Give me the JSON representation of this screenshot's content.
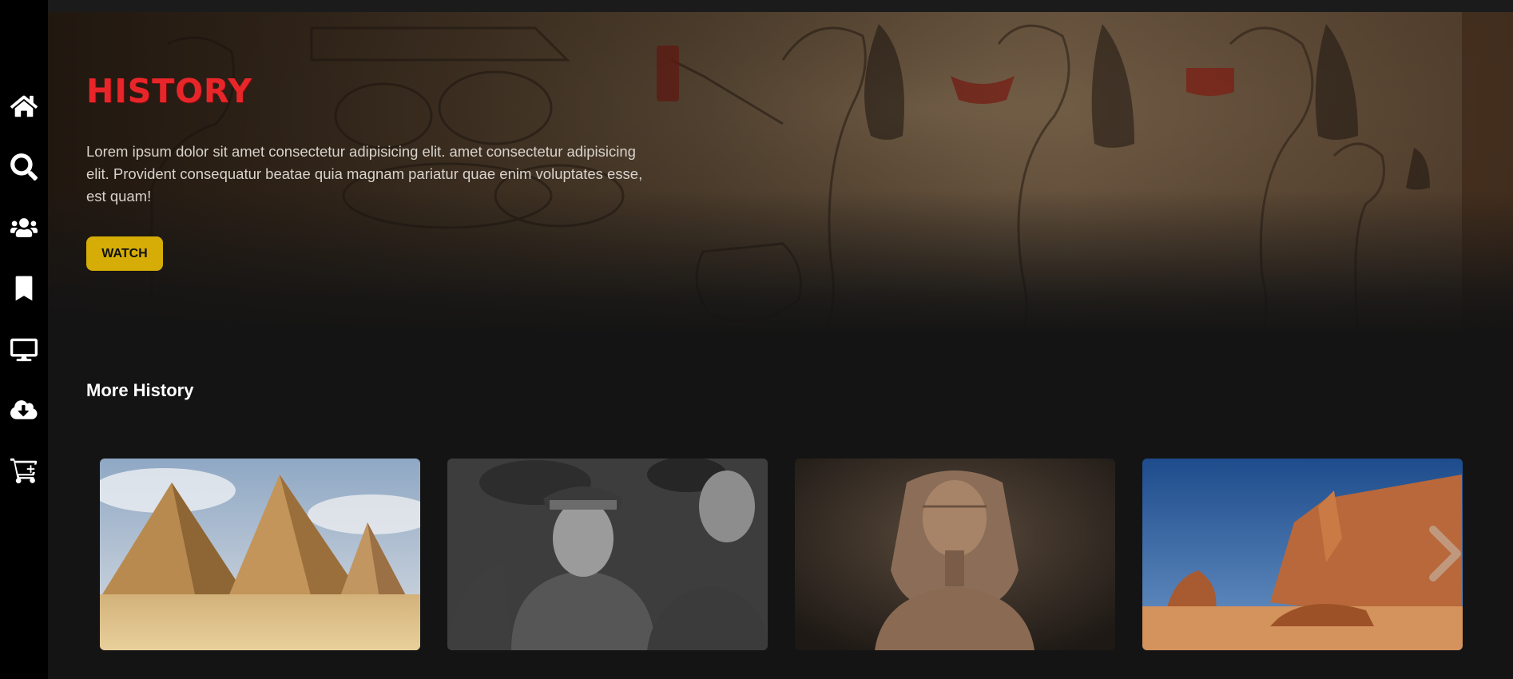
{
  "sidebar": {
    "items": [
      {
        "icon": "home-icon"
      },
      {
        "icon": "search-icon"
      },
      {
        "icon": "users-icon"
      },
      {
        "icon": "bookmark-icon"
      },
      {
        "icon": "desktop-icon"
      },
      {
        "icon": "cloud-download-icon"
      },
      {
        "icon": "cart-icon"
      }
    ]
  },
  "hero": {
    "title": "HISTORY",
    "description": "Lorem ipsum dolor sit amet consectetur adipisicing elit. amet consectetur adipisicing elit. Provident consequatur beatae quia magnam pariatur quae enim voluptates esse, est quam!",
    "watch_label": "WATCH",
    "title_color": "#e8262a",
    "button_color": "#d5ad06"
  },
  "section": {
    "title": "More History"
  },
  "cards": [
    {
      "image": "pyramids"
    },
    {
      "image": "soldiers"
    },
    {
      "image": "pharaoh-statue"
    },
    {
      "image": "desert-rocks"
    }
  ],
  "colors": {
    "background": "#141414",
    "sidebar": "#000000"
  }
}
